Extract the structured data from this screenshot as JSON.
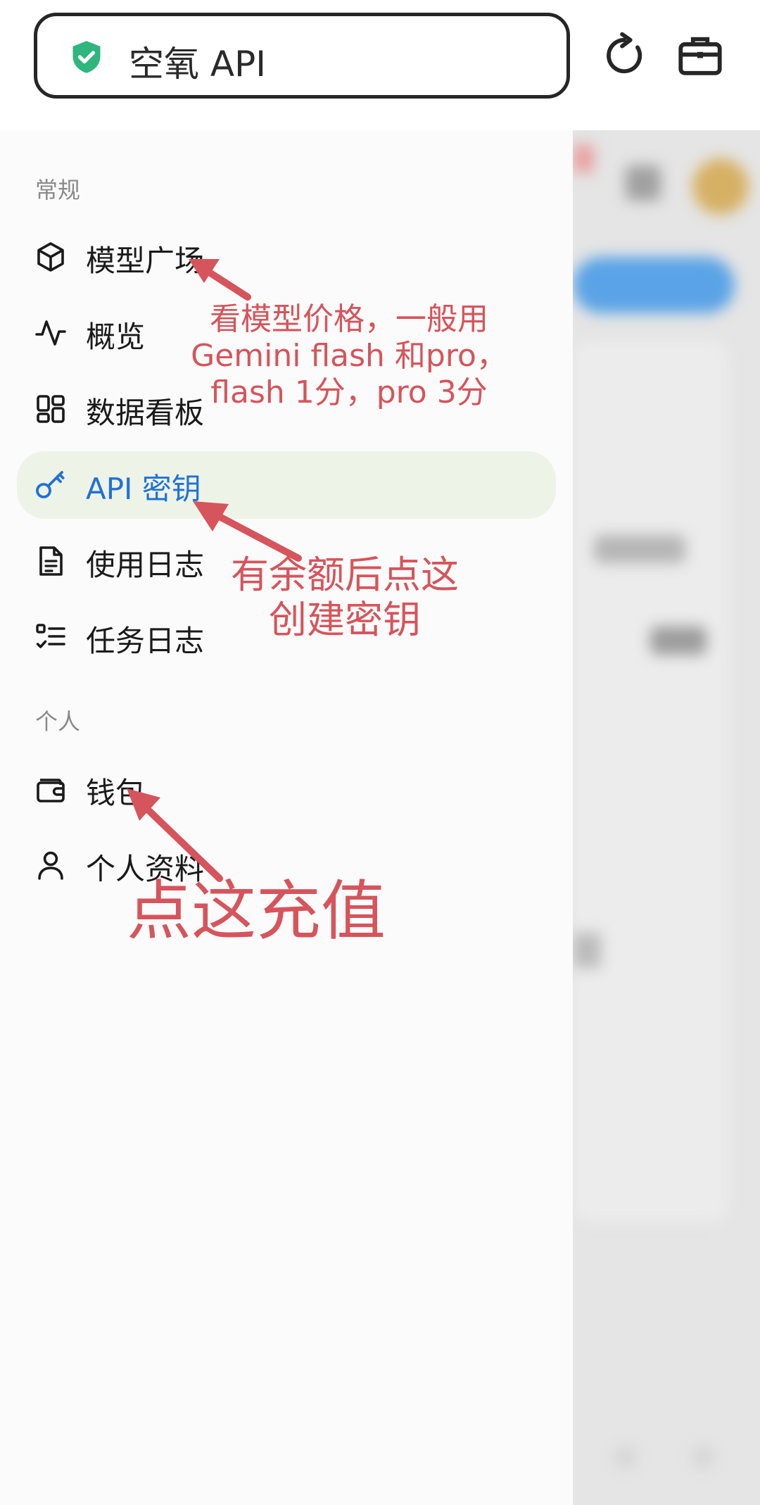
{
  "browser": {
    "site_name": "空氧 API",
    "security_icon": "shield-check-icon",
    "refresh_icon": "refresh-icon",
    "toolbox_icon": "briefcase-icon"
  },
  "sidebar": {
    "sections": [
      {
        "label": "常规",
        "items": [
          {
            "label": "模型广场",
            "icon": "cube-icon"
          },
          {
            "label": "概览",
            "icon": "activity-icon"
          },
          {
            "label": "数据看板",
            "icon": "dashboard-icon"
          },
          {
            "label": "API 密钥",
            "icon": "key-icon",
            "active": true
          },
          {
            "label": "使用日志",
            "icon": "document-icon"
          },
          {
            "label": "任务日志",
            "icon": "checklist-icon"
          }
        ]
      },
      {
        "label": "个人",
        "items": [
          {
            "label": "钱包",
            "icon": "wallet-icon"
          },
          {
            "label": "个人资料",
            "icon": "user-icon"
          }
        ]
      }
    ]
  },
  "annotations": {
    "pricing_note": [
      "看模型价格，一般用",
      "Gemini flash 和pro，",
      "flash 1分，pro 3分"
    ],
    "key_note": [
      "有余额后点这",
      "创建密钥"
    ],
    "recharge_note": "点这充值",
    "color": "#d6545b"
  },
  "colors": {
    "active_bg": "#eef3e7",
    "active_text": "#1f72d6",
    "shield_green": "#2fb57e"
  }
}
